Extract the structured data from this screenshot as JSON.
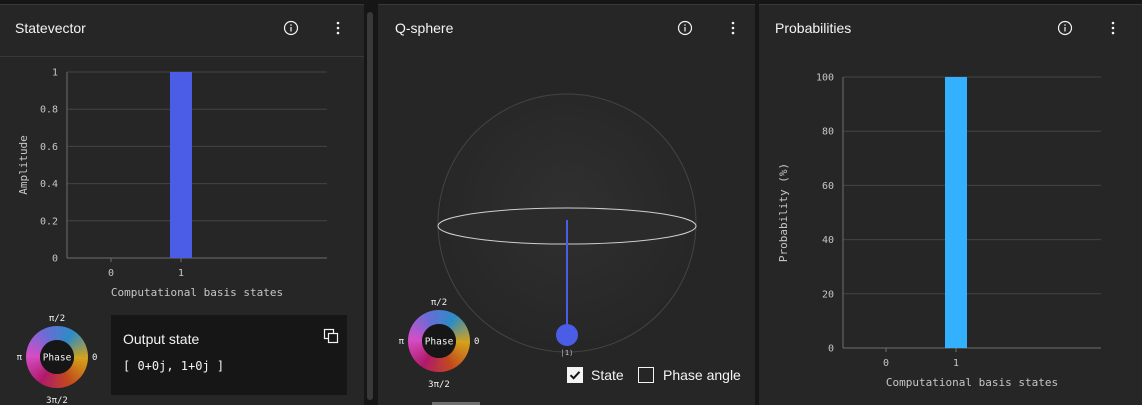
{
  "statevector": {
    "title": "Statevector",
    "info_icon": "info-icon",
    "menu_icon": "overflow-menu-icon",
    "chart_data": {
      "type": "bar",
      "categories": [
        "0",
        "1"
      ],
      "values": [
        0,
        1
      ],
      "xlabel": "Computational basis states",
      "ylabel": "Amplitude",
      "ylim": [
        0,
        1
      ],
      "yticks": [
        "0",
        "0.2",
        "0.4",
        "0.6",
        "0.8",
        "1"
      ],
      "grid": true,
      "bar_color": "#4b5ce6"
    },
    "phase_wheel": {
      "center": "Phase",
      "top": "π/2",
      "left": "π",
      "right": "0",
      "bottom": "3π/2"
    },
    "output": {
      "title": "Output state",
      "value": "[ 0+0j, 1+0j ]",
      "copy_icon": "copy-icon"
    }
  },
  "qsphere": {
    "title": "Q-sphere",
    "info_icon": "info-icon",
    "menu_icon": "overflow-menu-icon",
    "state_label": "|1⟩",
    "node_color": "#4b5ce6",
    "phase_wheel": {
      "center": "Phase",
      "top": "π/2",
      "left": "π",
      "right": "0",
      "bottom": "3π/2"
    },
    "state_checkbox": {
      "label": "State",
      "checked": true
    },
    "phase_angle_checkbox": {
      "label": "Phase angle",
      "checked": false
    }
  },
  "probabilities": {
    "title": "Probabilities",
    "info_icon": "info-icon",
    "menu_icon": "overflow-menu-icon",
    "chart_data": {
      "type": "bar",
      "categories": [
        "0",
        "1"
      ],
      "values": [
        0,
        100
      ],
      "xlabel": "Computational basis states",
      "ylabel": "Probability (%)",
      "ylim": [
        0,
        100
      ],
      "yticks": [
        "0",
        "20",
        "40",
        "60",
        "80",
        "100"
      ],
      "grid": true,
      "bar_color": "#33b1ff"
    }
  }
}
